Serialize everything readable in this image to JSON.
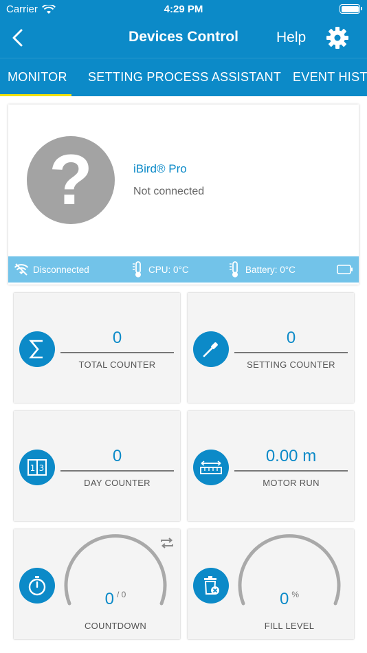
{
  "status_bar": {
    "carrier": "Carrier",
    "time": "4:29 PM"
  },
  "nav": {
    "title": "Devices Control",
    "help": "Help"
  },
  "tabs": [
    {
      "label": "MONITOR",
      "selected": true
    },
    {
      "label": "SETTING PROCESS ASSISTANT",
      "selected": false
    },
    {
      "label": "EVENT HISTO",
      "selected": false
    }
  ],
  "device": {
    "avatar_glyph": "?",
    "name": "iBird® Pro",
    "connection": "Not connected",
    "info": {
      "network": "Disconnected",
      "cpu": "CPU: 0°C",
      "battery": "Battery: 0°C"
    }
  },
  "counters": {
    "total": {
      "value": "0",
      "label": "TOTAL COUNTER"
    },
    "setting": {
      "value": "0",
      "label": "SETTING COUNTER"
    },
    "day": {
      "value": "0",
      "label": "DAY COUNTER"
    },
    "motor": {
      "value": "0.00 m",
      "label": "MOTOR RUN"
    },
    "countdown": {
      "value": "0",
      "max": "/ 0",
      "label": "COUNTDOWN",
      "level": 0
    },
    "fill": {
      "value": "0",
      "unit": "%",
      "label": "FILL LEVEL",
      "level": 0
    }
  },
  "colors": {
    "primary": "#0c8ac8",
    "tab_indicator": "#f1e20c",
    "info_bar": "#72c3e9",
    "avatar": "#a3a3a3",
    "gauge_track": "#a9a9a9"
  }
}
